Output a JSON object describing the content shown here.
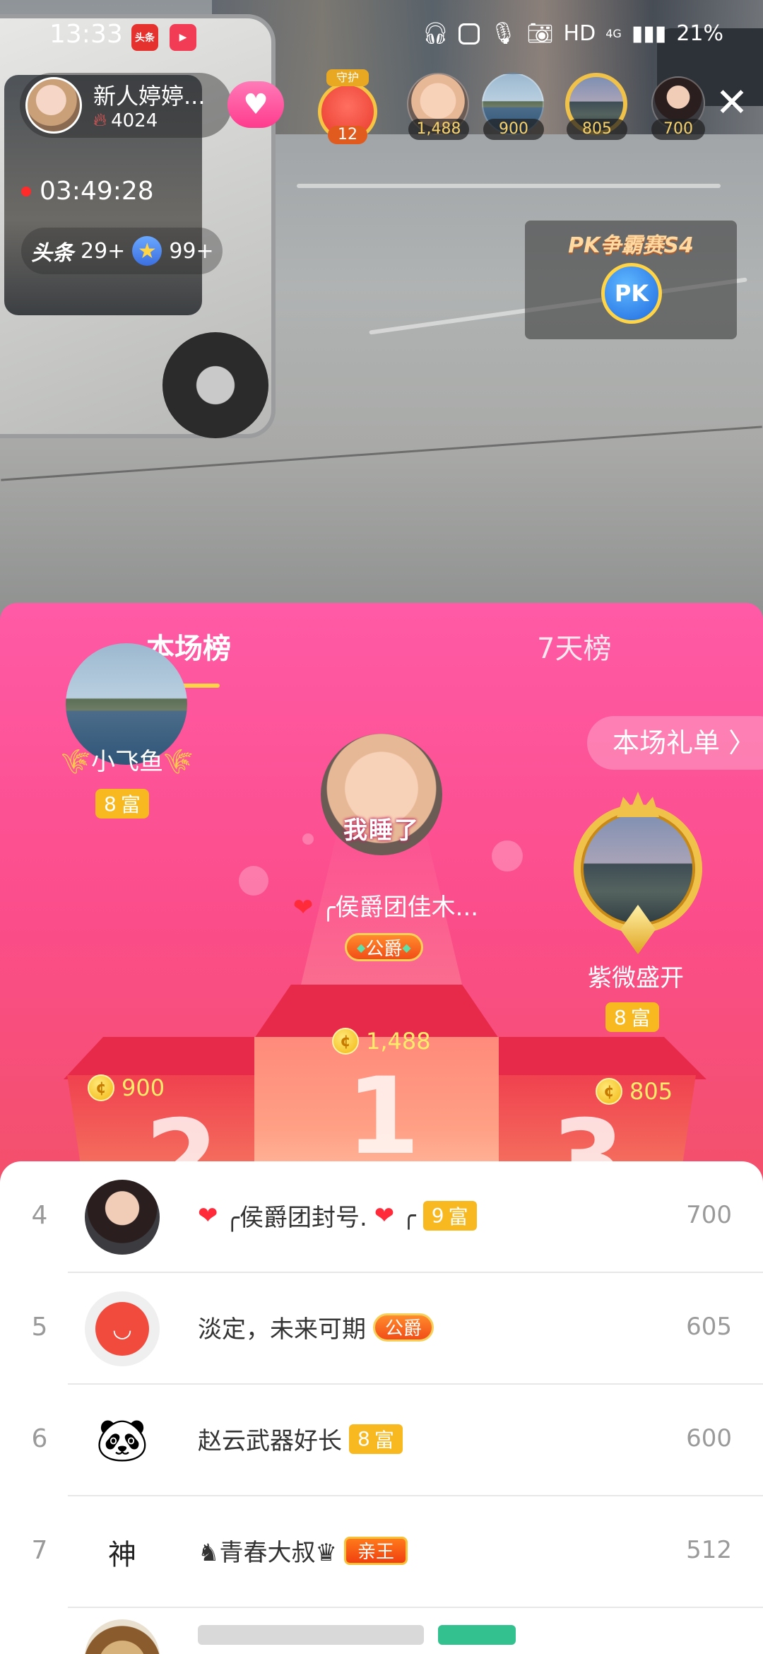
{
  "status_bar": {
    "time": "13:33",
    "app_badges": [
      "头条",
      "▶"
    ],
    "right_text": "HD",
    "network": "4G",
    "battery": "21%"
  },
  "host": {
    "name": "新人婷婷...",
    "heat": "4024",
    "live_duration": "03:49:28"
  },
  "guard": {
    "label": "守护",
    "count": "12"
  },
  "top_viewers": [
    {
      "count": "1,488"
    },
    {
      "count": "900"
    },
    {
      "count": "805"
    },
    {
      "count": "700"
    }
  ],
  "stats": {
    "logo": "头条",
    "logo_count": "29+",
    "star_count": "99+"
  },
  "pk": {
    "title": "PK争霸赛S4",
    "button": "PK"
  },
  "tabs": {
    "current": "本场榜",
    "week": "7天榜"
  },
  "gift_list_button": "本场礼单 〉",
  "podium": {
    "first": {
      "caption": "我睡了",
      "name": "╭侯爵团佳木...",
      "badge": "公爵",
      "score": "1,488",
      "rank_mark": "1"
    },
    "second": {
      "name": "小飞鱼",
      "badge_level": "8",
      "badge_label": "富",
      "score": "900",
      "rank_mark": "2"
    },
    "third": {
      "name": "紫微盛开",
      "badge_level": "8",
      "badge_label": "富",
      "score": "805",
      "rank_mark": "3"
    }
  },
  "ranking_list": [
    {
      "rank": "4",
      "name": "╭侯爵团封号.",
      "name_suffix": "╭",
      "badge_type": "fu",
      "badge_level": "9",
      "badge_label": "富",
      "score": "700"
    },
    {
      "rank": "5",
      "name": "淡定，未来可期",
      "badge_type": "duke",
      "badge_label": "公爵",
      "score": "605"
    },
    {
      "rank": "6",
      "name": "赵云武器好长",
      "badge_type": "fu",
      "badge_level": "8",
      "badge_label": "富",
      "score": "600"
    },
    {
      "rank": "7",
      "name": "♞青春大叔♛",
      "badge_type": "king",
      "badge_label": "亲王",
      "score": "512"
    }
  ],
  "row7_avatar_char": "神",
  "colors": {
    "sheet_pink": "#ff5aa6",
    "sheet_red": "#ee4f63",
    "badge_gold": "#f8b820",
    "coin_text": "#ffeb6a"
  },
  "icons": {
    "close": "close-icon",
    "follow": "heart-wings-icon",
    "coin": "coin-icon",
    "star": "star-icon",
    "flame": "flame-icon"
  }
}
